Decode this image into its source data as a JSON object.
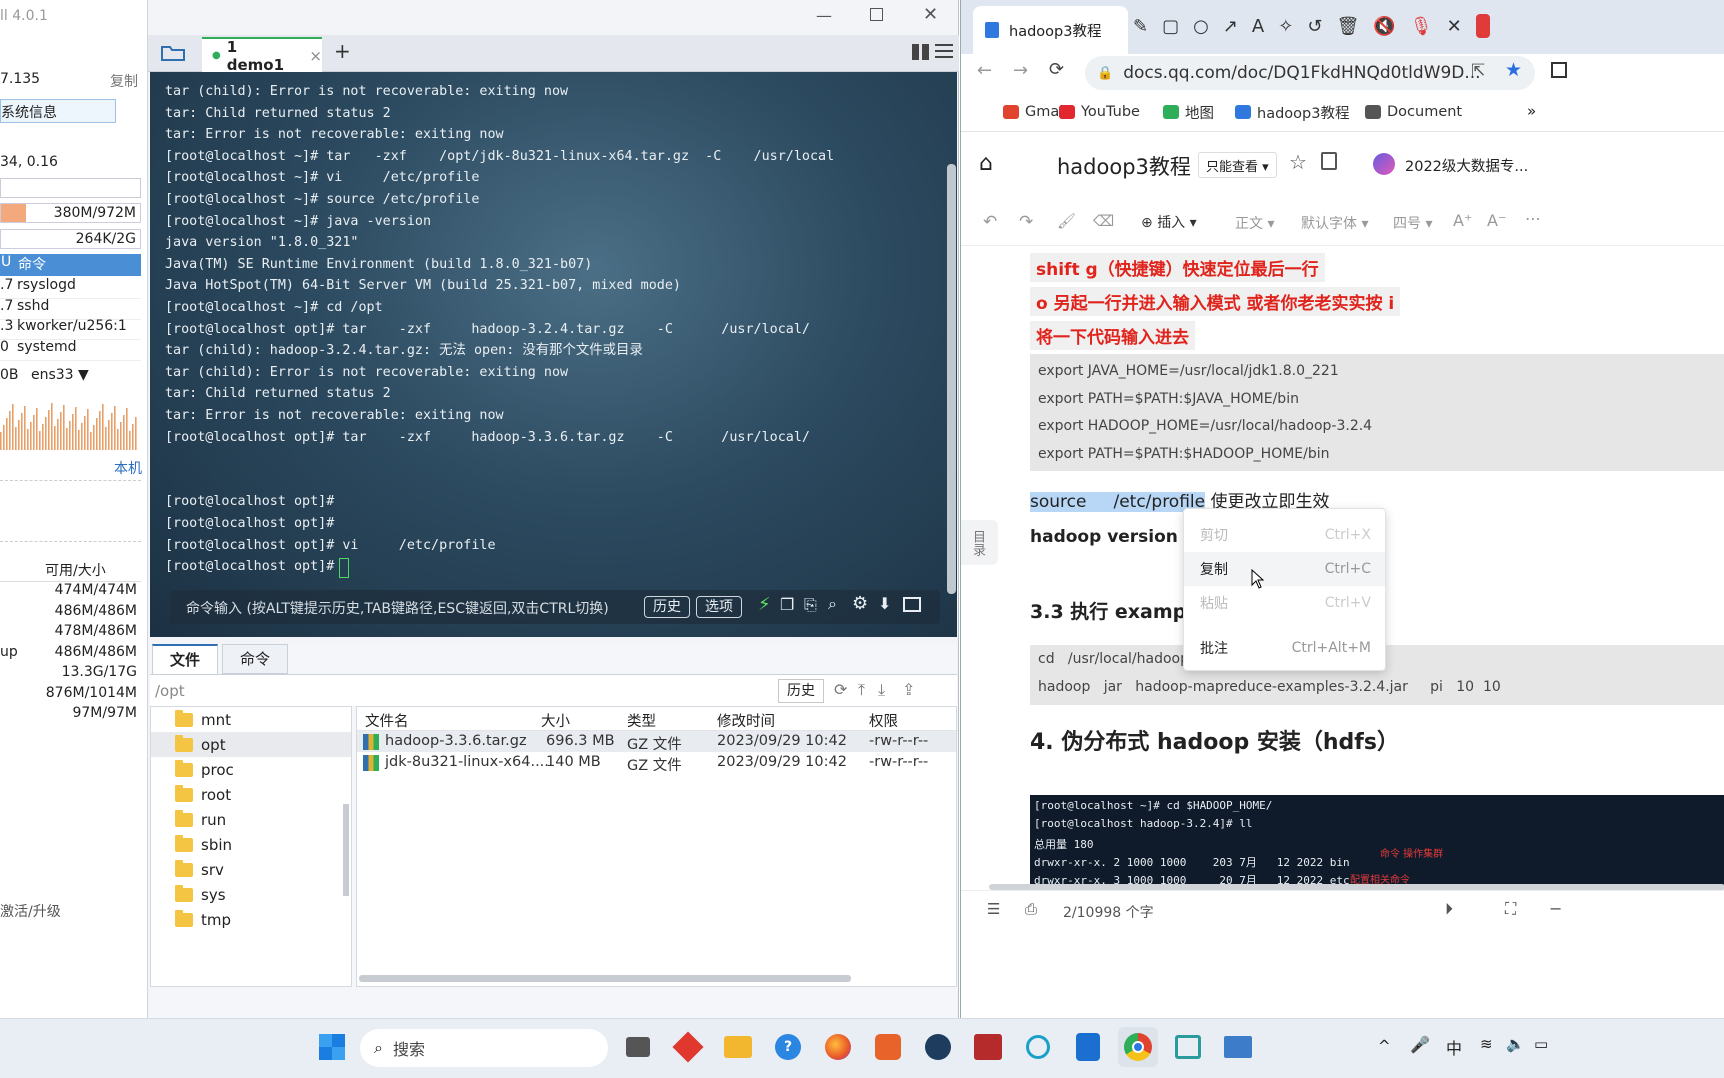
{
  "left_panel": {
    "app_title": "ll 4.0.1",
    "ip": "7.135",
    "copy": "复制",
    "sysinfo_btn": "系统信息",
    "load": "34, 0.16",
    "mem": "380M/972M",
    "swap": "264K/2G",
    "proc_header": "命令",
    "proc_header_prefix": "U",
    "processes": [
      {
        "pct": ".7",
        "name": "rsyslogd"
      },
      {
        "pct": ".7",
        "name": "sshd"
      },
      {
        "pct": ".3",
        "name": "kworker/u256:1"
      },
      {
        "pct": "0",
        "name": "systemd"
      }
    ],
    "net_prefix": "0B",
    "net_iface": "ens33",
    "local_link": "本机",
    "disk_header": "可用/大小",
    "disks": [
      {
        "name": "",
        "size": "474M/474M"
      },
      {
        "name": "",
        "size": "486M/486M"
      },
      {
        "name": "",
        "size": "478M/486M"
      },
      {
        "name": "up",
        "size": "486M/486M"
      },
      {
        "name": "",
        "size": "13.3G/17G"
      },
      {
        "name": "",
        "size": "876M/1014M"
      },
      {
        "name": "",
        "size": "97M/97M"
      }
    ],
    "activate": "激活/升级"
  },
  "terminal": {
    "tab_label": "1 demo1",
    "tab_close": "×",
    "tab_add": "+",
    "lines": [
      "tar (child): Error is not recoverable: exiting now",
      "tar: Child returned status 2",
      "tar: Error is not recoverable: exiting now",
      "[root@localhost ~]# tar   -zxf    /opt/jdk-8u321-linux-x64.tar.gz  -C    /usr/local",
      "[root@localhost ~]# vi     /etc/profile",
      "[root@localhost ~]# source /etc/profile",
      "[root@localhost ~]# java -version",
      "java version \"1.8.0_321\"",
      "Java(TM) SE Runtime Environment (build 1.8.0_321-b07)",
      "Java HotSpot(TM) 64-Bit Server VM (build 25.321-b07, mixed mode)",
      "[root@localhost ~]# cd /opt",
      "[root@localhost opt]# tar    -zxf     hadoop-3.2.4.tar.gz    -C      /usr/local/",
      "tar (child): hadoop-3.2.4.tar.gz: 无法 open: 没有那个文件或目录",
      "tar (child): Error is not recoverable: exiting now",
      "tar: Child returned status 2",
      "tar: Error is not recoverable: exiting now",
      "[root@localhost opt]# tar    -zxf     hadoop-3.3.6.tar.gz    -C      /usr/local/",
      "",
      "",
      "[root@localhost opt]#",
      "[root@localhost opt]#",
      "[root@localhost opt]# vi     /etc/profile",
      "[root@localhost opt]# "
    ],
    "cmd_hint": "命令输入 (按ALT键提示历史,TAB键路径,ESC键返回,双击CTRL切换)",
    "history_btn": "历史",
    "options_btn": "选项"
  },
  "files": {
    "tab_files": "文件",
    "tab_cmd": "命令",
    "path": "/opt",
    "history_btn": "历史",
    "tree": [
      "mnt",
      "opt",
      "proc",
      "root",
      "run",
      "sbin",
      "srv",
      "sys",
      "tmp"
    ],
    "columns": [
      "文件名",
      "大小",
      "类型",
      "修改时间",
      "权限"
    ],
    "rows": [
      {
        "name": "hadoop-3.3.6.tar.gz",
        "size": "696.3 MB",
        "type": "GZ 文件",
        "mtime": "2023/09/29 10:42",
        "perm": "-rw-r--r--"
      },
      {
        "name": "jdk-8u321-linux-x64....",
        "size": "140 MB",
        "type": "GZ 文件",
        "mtime": "2023/09/29 10:42",
        "perm": "-rw-r--r--"
      }
    ]
  },
  "browser": {
    "tab_title": "hadoop3教程",
    "url": "docs.qq.com/doc/DQ1FkdHNQd0tldW9D...",
    "bookmarks": [
      "Gmail",
      "YouTube",
      "地图",
      "hadoop3教程",
      "Document"
    ],
    "more": "»",
    "doc_title": "hadoop3教程",
    "readonly": "只能查看",
    "team": "2022级大数据专...",
    "toolbar": {
      "insert": "插入",
      "style": "正文",
      "font": "默认字体",
      "size": "四号"
    },
    "red_lines": [
      "shift g（快捷键）快速定位最后一行",
      "o 另起一行并进入输入模式  或者你老老实实按 i",
      "将一下代码输入进去"
    ],
    "code1": [
      "export JAVA_HOME=/usr/local/jdk1.8.0_221",
      "export PATH=$PATH:$JAVA_HOME/bin",
      "export HADOOP_HOME=/usr/local/hadoop-3.2.4",
      "export PATH=$PATH:$HADOOP_HOME/bin"
    ],
    "source_sel": "source     /etc/profile",
    "source_rest": " 使更改立即生效",
    "hadoop_version": "hadoop  version 可",
    "toc": "目录",
    "h33": "3.3 执行 exampl",
    "h33_tail": "",
    "code2": [
      "cd   /usr/local/hadoop-3",
      "hadoop   jar   hadoop-mapreduce-examples-3.2.4.jar     pi   10  10"
    ],
    "h4": "4.  伪分布式 hadoop 安装（hdfs）",
    "img_lines": [
      "[root@localhost ~]# cd $HADOOP_HOME/",
      "[root@localhost hadoop-3.2.4]# ll",
      "总用量 180",
      "drwxr-xr-x. 2 1000 1000    203 7月   12 2022 bin",
      "drwxr-xr-x. 3 1000 1000     20 7月   12 2022 etc"
    ],
    "img_annot1": "命令 操作集群",
    "img_annot2": "配置相关命令",
    "word_count": "2/10998 个字",
    "context_menu": [
      {
        "label": "剪切",
        "key": "Ctrl+X",
        "enabled": false
      },
      {
        "label": "复制",
        "key": "Ctrl+C",
        "enabled": true
      },
      {
        "label": "粘贴",
        "key": "Ctrl+V",
        "enabled": false
      },
      {
        "label": "批注",
        "key": "Ctrl+Alt+M",
        "enabled": true
      }
    ]
  },
  "taskbar": {
    "search": "搜索",
    "ime": "中"
  }
}
